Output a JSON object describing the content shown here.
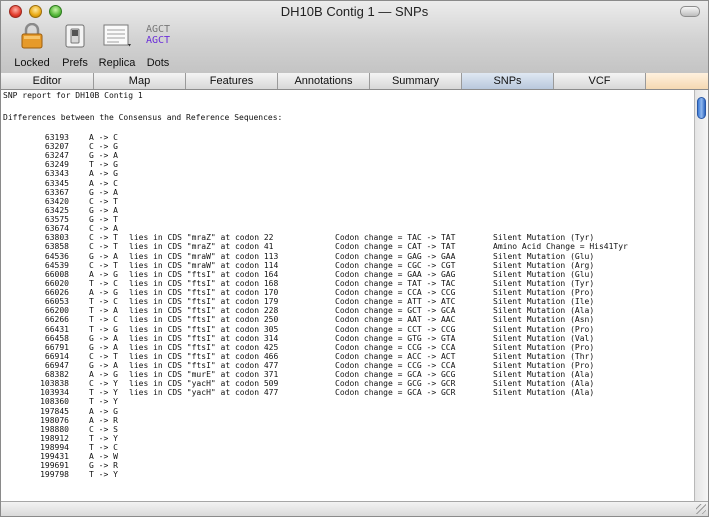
{
  "window": {
    "title": "DH10B Contig 1 — SNPs"
  },
  "toolbar": {
    "locked_label": "Locked",
    "prefs_label": "Prefs",
    "replica_label": "Replica",
    "dots_label": "Dots",
    "dots_icon_text": {
      "top": "AGCT",
      "bottom": "AGCT"
    }
  },
  "tabs": [
    {
      "label": "Editor"
    },
    {
      "label": "Map"
    },
    {
      "label": "Features"
    },
    {
      "label": "Annotations"
    },
    {
      "label": "Summary"
    },
    {
      "label": "SNPs",
      "active": true
    },
    {
      "label": "VCF"
    }
  ],
  "report": {
    "title": "SNP report for DH10B Contig 1",
    "subtitle": "Differences between the Consensus and Reference Sequences:",
    "rows": [
      {
        "pos": "63193",
        "change": "A -> C"
      },
      {
        "pos": "63207",
        "change": "C -> G"
      },
      {
        "pos": "63247",
        "change": "G -> A"
      },
      {
        "pos": "63249",
        "change": "T -> G"
      },
      {
        "pos": "63343",
        "change": "A -> G"
      },
      {
        "pos": "63345",
        "change": "A -> C"
      },
      {
        "pos": "63367",
        "change": "G -> A"
      },
      {
        "pos": "63420",
        "change": "C -> T"
      },
      {
        "pos": "63425",
        "change": "G -> A"
      },
      {
        "pos": "63575",
        "change": "G -> T"
      },
      {
        "pos": "63674",
        "change": "C -> A"
      },
      {
        "pos": "63803",
        "change": "C -> T",
        "cds": "lies in CDS \"mraZ\" at codon 22",
        "codon": "Codon change = TAC -> TAT",
        "effect": "Silent Mutation (Tyr)"
      },
      {
        "pos": "63858",
        "change": "C -> T",
        "cds": "lies in CDS \"mraZ\" at codon 41",
        "codon": "Codon change = CAT -> TAT",
        "effect": "Amino Acid Change = His41Tyr"
      },
      {
        "pos": "64536",
        "change": "G -> A",
        "cds": "lies in CDS \"mraW\" at codon 113",
        "codon": "Codon change = GAG -> GAA",
        "effect": "Silent Mutation (Glu)"
      },
      {
        "pos": "64539",
        "change": "C -> T",
        "cds": "lies in CDS \"mraW\" at codon 114",
        "codon": "Codon change = CGC -> CGT",
        "effect": "Silent Mutation (Arg)"
      },
      {
        "pos": "66008",
        "change": "A -> G",
        "cds": "lies in CDS \"ftsI\" at codon 164",
        "codon": "Codon change = GAA -> GAG",
        "effect": "Silent Mutation (Glu)"
      },
      {
        "pos": "66020",
        "change": "T -> C",
        "cds": "lies in CDS \"ftsI\" at codon 168",
        "codon": "Codon change = TAT -> TAC",
        "effect": "Silent Mutation (Tyr)"
      },
      {
        "pos": "66026",
        "change": "A -> G",
        "cds": "lies in CDS \"ftsI\" at codon 170",
        "codon": "Codon change = CCA -> CCG",
        "effect": "Silent Mutation (Pro)"
      },
      {
        "pos": "66053",
        "change": "T -> C",
        "cds": "lies in CDS \"ftsI\" at codon 179",
        "codon": "Codon change = ATT -> ATC",
        "effect": "Silent Mutation (Ile)"
      },
      {
        "pos": "66200",
        "change": "T -> A",
        "cds": "lies in CDS \"ftsI\" at codon 228",
        "codon": "Codon change = GCT -> GCA",
        "effect": "Silent Mutation (Ala)"
      },
      {
        "pos": "66266",
        "change": "T -> C",
        "cds": "lies in CDS \"ftsI\" at codon 250",
        "codon": "Codon change = AAT -> AAC",
        "effect": "Silent Mutation (Asn)"
      },
      {
        "pos": "66431",
        "change": "T -> G",
        "cds": "lies in CDS \"ftsI\" at codon 305",
        "codon": "Codon change = CCT -> CCG",
        "effect": "Silent Mutation (Pro)"
      },
      {
        "pos": "66458",
        "change": "G -> A",
        "cds": "lies in CDS \"ftsI\" at codon 314",
        "codon": "Codon change = GTG -> GTA",
        "effect": "Silent Mutation (Val)"
      },
      {
        "pos": "66791",
        "change": "G -> A",
        "cds": "lies in CDS \"ftsI\" at codon 425",
        "codon": "Codon change = CCG -> CCA",
        "effect": "Silent Mutation (Pro)"
      },
      {
        "pos": "66914",
        "change": "C -> T",
        "cds": "lies in CDS \"ftsI\" at codon 466",
        "codon": "Codon change = ACC -> ACT",
        "effect": "Silent Mutation (Thr)"
      },
      {
        "pos": "66947",
        "change": "G -> A",
        "cds": "lies in CDS \"ftsI\" at codon 477",
        "codon": "Codon change = CCG -> CCA",
        "effect": "Silent Mutation (Pro)"
      },
      {
        "pos": "68382",
        "change": "A -> G",
        "cds": "lies in CDS \"murE\" at codon 371",
        "codon": "Codon change = GCA -> GCG",
        "effect": "Silent Mutation (Ala)"
      },
      {
        "pos": "103838",
        "change": "C -> Y",
        "cds": "lies in CDS \"yacH\" at codon 509",
        "codon": "Codon change = GCG -> GCR",
        "effect": "Silent Mutation (Ala)"
      },
      {
        "pos": "103934",
        "change": "T -> Y",
        "cds": "lies in CDS \"yacH\" at codon 477",
        "codon": "Codon change = GCA -> GCR",
        "effect": "Silent Mutation (Ala)"
      },
      {
        "pos": "108360",
        "change": "T -> Y"
      },
      {
        "pos": "197845",
        "change": "A -> G"
      },
      {
        "pos": "198076",
        "change": "A -> R"
      },
      {
        "pos": "198880",
        "change": "C -> S"
      },
      {
        "pos": "198912",
        "change": "T -> Y"
      },
      {
        "pos": "198994",
        "change": "T -> C"
      },
      {
        "pos": "199431",
        "change": "A -> W"
      },
      {
        "pos": "199691",
        "change": "G -> R"
      },
      {
        "pos": "199798",
        "change": "T -> Y"
      }
    ]
  }
}
